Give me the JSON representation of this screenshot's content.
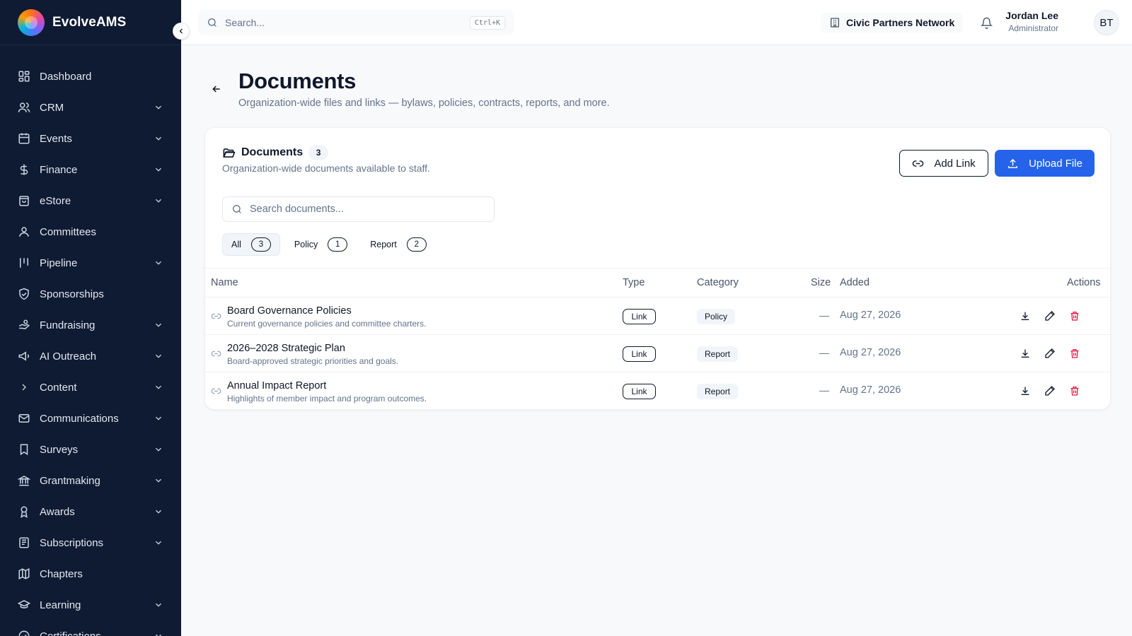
{
  "brand": {
    "name": "EvolveAMS"
  },
  "sidebar": {
    "items": [
      {
        "label": "Dashboard",
        "icon": "dashboard-icon",
        "expandable": false
      },
      {
        "label": "CRM",
        "icon": "users-icon",
        "expandable": true
      },
      {
        "label": "Events",
        "icon": "calendar-icon",
        "expandable": true
      },
      {
        "label": "Finance",
        "icon": "dollar-icon",
        "expandable": true
      },
      {
        "label": "eStore",
        "icon": "store-bag-icon",
        "expandable": true
      },
      {
        "label": "Committees",
        "icon": "user-icon",
        "expandable": false
      },
      {
        "label": "Pipeline",
        "icon": "kanban-icon",
        "expandable": true
      },
      {
        "label": "Sponsorships",
        "icon": "shield-handshake-icon",
        "expandable": false
      },
      {
        "label": "Fundraising",
        "icon": "hand-coins-icon",
        "expandable": true
      },
      {
        "label": "AI Outreach",
        "icon": "megaphone-icon",
        "expandable": true
      },
      {
        "label": "Content",
        "icon": "chevron-right-icon",
        "expandable": true
      },
      {
        "label": "Communications",
        "icon": "mail-icon",
        "expandable": true
      },
      {
        "label": "Surveys",
        "icon": "bookmark-icon",
        "expandable": true
      },
      {
        "label": "Grantmaking",
        "icon": "landmark-icon",
        "expandable": true
      },
      {
        "label": "Awards",
        "icon": "award-icon",
        "expandable": true
      },
      {
        "label": "Subscriptions",
        "icon": "newspaper-icon",
        "expandable": true
      },
      {
        "label": "Chapters",
        "icon": "map-icon",
        "expandable": false
      },
      {
        "label": "Learning",
        "icon": "graduation-cap-icon",
        "expandable": true
      },
      {
        "label": "Certifications",
        "icon": "badge-check-icon",
        "expandable": true
      }
    ]
  },
  "header": {
    "search_placeholder": "Search...",
    "shortcut": "Ctrl+K",
    "org_name": "Civic Partners Network",
    "user_name": "Jordan Lee",
    "user_role": "Administrator",
    "avatar_initials": "BT"
  },
  "page": {
    "title": "Documents",
    "subtitle": "Organization-wide files and links — bylaws, policies, contracts, reports, and more."
  },
  "card": {
    "title": "Documents",
    "count": "3",
    "description": "Organization-wide documents available to staff.",
    "add_link_label": "Add Link",
    "upload_label": "Upload File",
    "search_placeholder": "Search documents...",
    "filters": [
      {
        "label": "All",
        "count": "3",
        "active": true
      },
      {
        "label": "Policy",
        "count": "1",
        "active": false
      },
      {
        "label": "Report",
        "count": "2",
        "active": false
      }
    ]
  },
  "table": {
    "columns": {
      "name": "Name",
      "type": "Type",
      "category": "Category",
      "size": "Size",
      "added": "Added",
      "actions": "Actions"
    },
    "rows": [
      {
        "title": "Board Governance Policies",
        "description": "Current governance policies and committee charters.",
        "type": "Link",
        "category": "Policy",
        "size": "—",
        "added": "Aug 27, 2026"
      },
      {
        "title": "2026–2028 Strategic Plan",
        "description": "Board-approved strategic priorities and goals.",
        "type": "Link",
        "category": "Report",
        "size": "—",
        "added": "Aug 27, 2026"
      },
      {
        "title": "Annual Impact Report",
        "description": "Highlights of member impact and program outcomes.",
        "type": "Link",
        "category": "Report",
        "size": "—",
        "added": "Aug 27, 2026"
      }
    ]
  },
  "colors": {
    "sidebar_bg": "#0f1b33",
    "primary": "#2563eb",
    "danger": "#e11d48"
  }
}
